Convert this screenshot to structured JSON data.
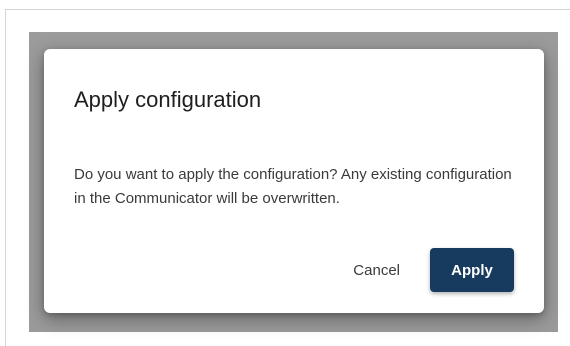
{
  "dialog": {
    "title": "Apply configuration",
    "message": "Do you want to apply the configuration? Any existing configuration in the Communicator will be overwritten.",
    "cancel_label": "Cancel",
    "apply_label": "Apply"
  },
  "colors": {
    "primary": "#163b5e",
    "backdrop": "#9b9b9b"
  }
}
